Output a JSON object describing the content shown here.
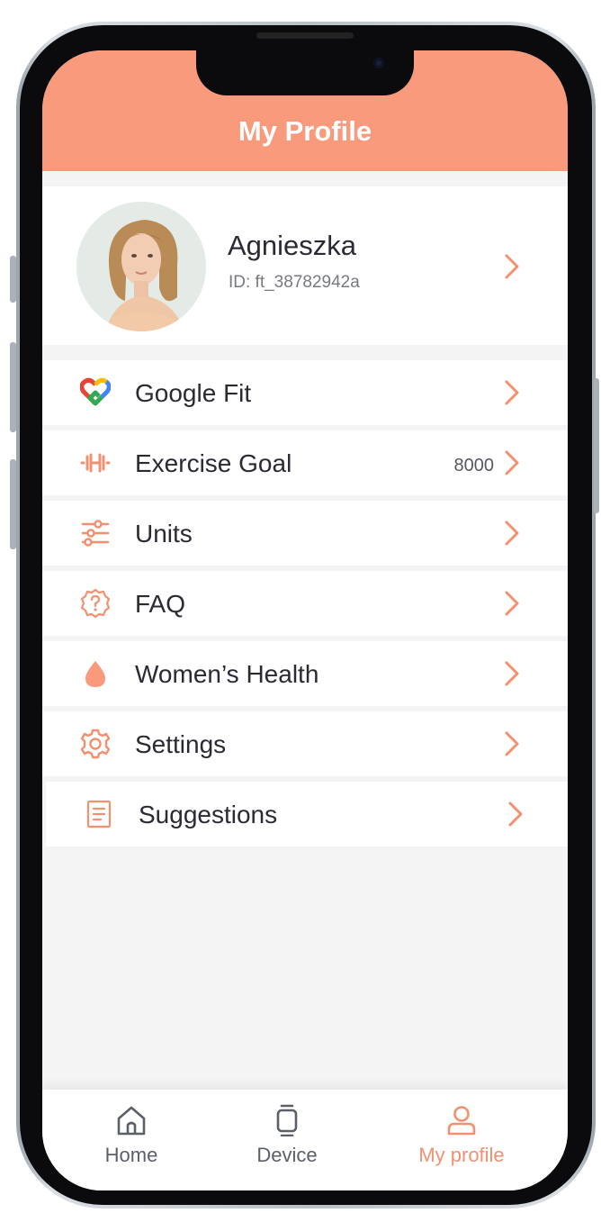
{
  "header": {
    "title": "My Profile"
  },
  "profile": {
    "name": "Agnieszka",
    "id": "ID: ft_38782942a"
  },
  "menu": [
    {
      "icon": "google-fit-heart-icon",
      "label": "Google Fit",
      "value": ""
    },
    {
      "icon": "dumbbell-icon",
      "label": "Exercise Goal",
      "value": "8000"
    },
    {
      "icon": "sliders-icon",
      "label": "Units",
      "value": ""
    },
    {
      "icon": "question-badge-icon",
      "label": "FAQ",
      "value": ""
    },
    {
      "icon": "drop-icon",
      "label": "Women’s Health",
      "value": ""
    },
    {
      "icon": "gear-icon",
      "label": "Settings",
      "value": ""
    },
    {
      "icon": "document-icon",
      "label": "Suggestions",
      "value": ""
    }
  ],
  "tabs": [
    {
      "icon": "home-icon",
      "label": "Home",
      "active": false
    },
    {
      "icon": "watch-icon",
      "label": "Device",
      "active": false
    },
    {
      "icon": "user-icon",
      "label": "My profile",
      "active": true
    }
  ],
  "colors": {
    "accent": "#f99a7c",
    "text": "#2a2a33",
    "tab_inactive": "#5b6068"
  }
}
